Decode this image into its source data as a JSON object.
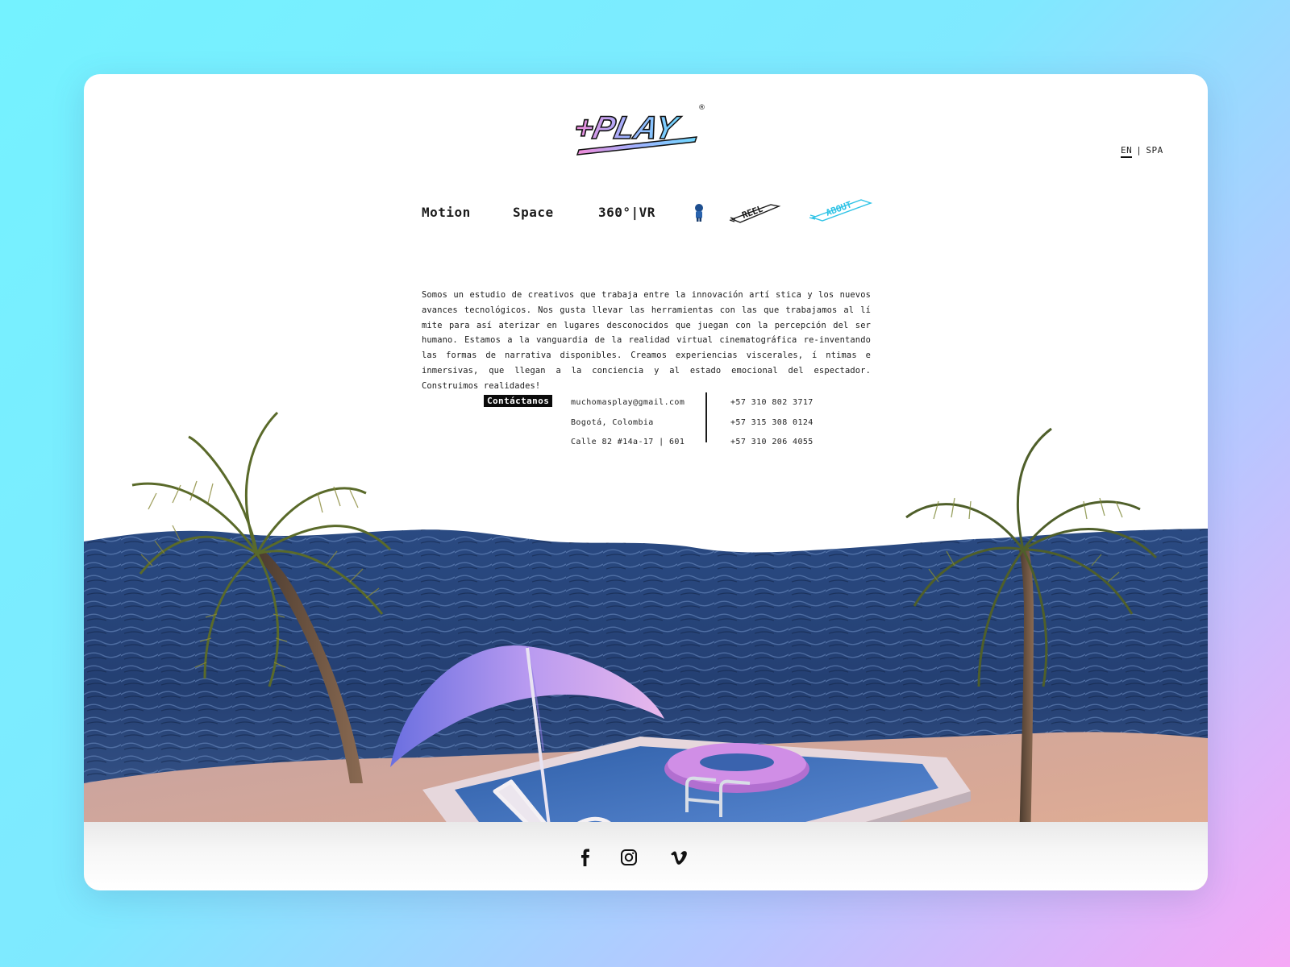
{
  "brand": {
    "logo_text": "+PLAY",
    "registered": "®"
  },
  "language": {
    "en": "EN",
    "separator": "|",
    "spa": "SPA"
  },
  "nav": {
    "motion": "Motion",
    "space": "Space",
    "vr": "360°|VR",
    "reel": "REEL",
    "about": "ABOUT"
  },
  "about": {
    "text": "Somos un estudio de creativos que trabaja entre la innovación artí stica y los nuevos avances tecnológicos. Nos gusta llevar las herramientas con las que trabajamos al lí mite para así aterizar en lugares desconocidos que juegan con la percepción del ser humano. Estamos a la vanguardia de la realidad virtual cinematográfica re-inventando las formas de narrativa disponibles. Creamos experiencias viscerales, í ntimas e inmersivas, que llegan a la conciencia y al estado emocional del espectador. Construimos realidades!"
  },
  "contact": {
    "button": "Contáctanos",
    "email": "muchomasplay@gmail.com",
    "city": "Bogotá, Colombia",
    "address": "Calle 82 #14a-17 | 601",
    "phones": [
      "+57 310 802 3717",
      "+57 315 308 0124",
      "+57 310 206 4055"
    ]
  },
  "social": [
    "facebook-icon",
    "instagram-icon",
    "vimeo-icon"
  ],
  "colors": {
    "accent": "#2ec3e6",
    "brand_pink": "#f08ad8",
    "brand_cyan": "#6fd8ff",
    "ink": "#1b1b1b"
  }
}
